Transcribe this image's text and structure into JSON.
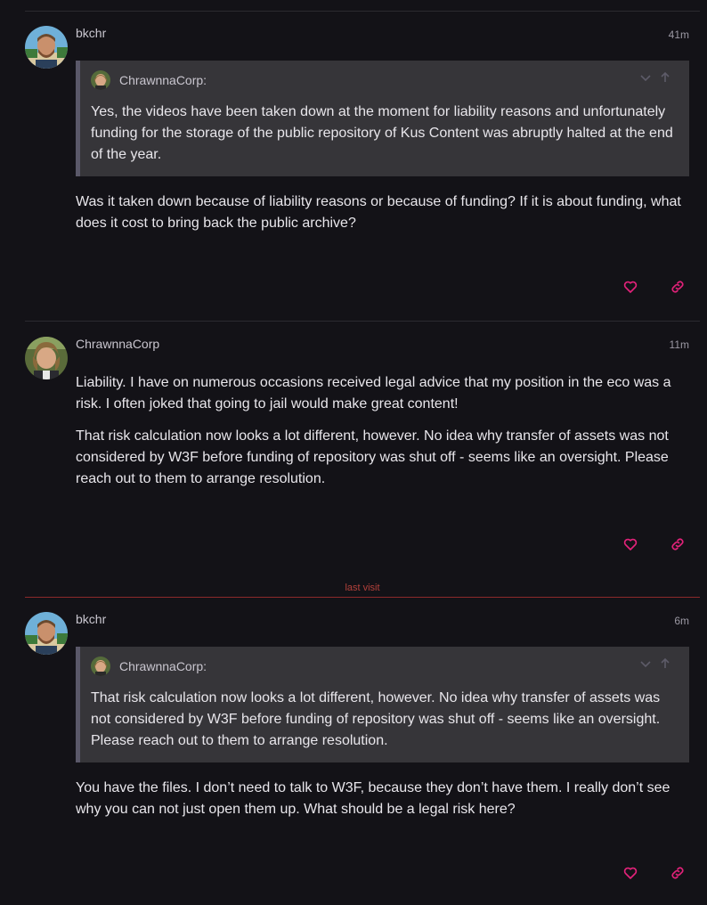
{
  "posts": [
    {
      "username": "bkchr",
      "date": "41m",
      "quote": {
        "author": "ChrawnnaCorp:",
        "text": "Yes, the videos have been taken down at the moment for liability reasons and unfortunately funding for the storage of the public repository of Kus Content was abruptly halted at the end of the year."
      },
      "paragraphs": [
        "Was it taken down because of liability reasons or because of funding? If it is about funding, what does it cost to bring back the public archive?"
      ]
    },
    {
      "username": "ChrawnnaCorp",
      "date": "11m",
      "paragraphs": [
        "Liability. I have on numerous occasions received legal advice that my position in the eco was a risk. I often joked that going to jail would make great content!",
        "That risk calculation now looks a lot different, however. No idea why transfer of assets was not considered by W3F before funding of repository was shut off - seems like an oversight. Please reach out to them to arrange resolution."
      ]
    },
    {
      "username": "bkchr",
      "date": "6m",
      "quote": {
        "author": "ChrawnnaCorp:",
        "text": "That risk calculation now looks a lot different, however. No idea why transfer of assets was not considered by W3F before funding of repository was shut off - seems like an oversight. Please reach out to them to arrange resolution."
      },
      "paragraphs": [
        "You have the files. I don’t need to talk to W3F, because they don’t have them. I really don’t see why you can not just open them up. What should be a legal risk here?"
      ]
    }
  ],
  "last_visit_label": "last visit",
  "colors": {
    "background": "#131217",
    "quote_background": "#363539",
    "accent_pink": "#e3227a",
    "last_visit": "#b3413b"
  },
  "icons": {
    "like": "heart-icon",
    "share": "link-icon",
    "expand": "chevron-down-icon",
    "jump": "arrow-up-icon"
  }
}
